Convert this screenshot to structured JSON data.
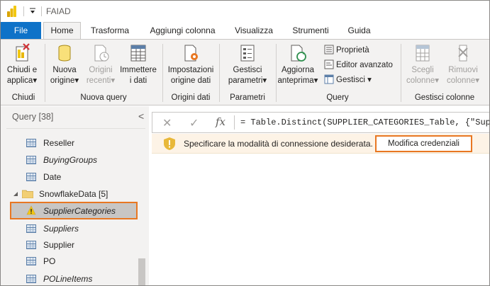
{
  "window": {
    "title": "FAIAD",
    "qat_symbol": "="
  },
  "tabs": [
    {
      "label": "File"
    },
    {
      "label": "Home"
    },
    {
      "label": "Trasforma"
    },
    {
      "label": "Aggiungi colonna"
    },
    {
      "label": "Visualizza"
    },
    {
      "label": "Strumenti"
    },
    {
      "label": "Guida"
    }
  ],
  "ribbon": {
    "close_apply": {
      "line1": "Chiudi e",
      "line2": "applica",
      "icon": "close-apply-icon"
    },
    "new_source": {
      "line1": "Nuova",
      "line2": "origine"
    },
    "recent_sources": {
      "line1": "Origini",
      "line2": "recenti"
    },
    "enter_data": {
      "line1": "Immettere",
      "line2": "i dati"
    },
    "source_settings": {
      "line1": "Impostazioni",
      "line2": "origine dati"
    },
    "manage_params": {
      "line1": "Gestisci",
      "line2": "parametri"
    },
    "refresh_preview": {
      "line1": "Aggiorna",
      "line2": "anteprima"
    },
    "properties": "Proprietà",
    "advanced_editor": "Editor avanzato",
    "manage": "Gestisci",
    "choose_columns": {
      "line1": "Scegli",
      "line2": "colonne"
    },
    "remove_columns": {
      "line1": "Rimuovi",
      "line2": "colonne"
    },
    "groups": {
      "close": "Chiudi",
      "new_query": "Nuova query",
      "data_sources": "Origini dati",
      "parameters": "Parametri",
      "query": "Query",
      "manage_columns": "Gestisci colonne"
    },
    "dropdown_caret": "▾"
  },
  "query_pane": {
    "header": "Query [38]",
    "collapse_symbol": "<",
    "items": [
      {
        "label": "Reseller"
      },
      {
        "label": "BuyingGroups"
      },
      {
        "label": "Date"
      },
      {
        "label": "SnowflakeData [5]"
      },
      {
        "label": "SupplierCategories"
      },
      {
        "label": "Suppliers"
      },
      {
        "label": "Supplier"
      },
      {
        "label": "PO"
      },
      {
        "label": "POLineItems"
      }
    ]
  },
  "formula_bar": {
    "cancel_symbol": "✕",
    "ok_symbol": "✓",
    "fx_label": "fx",
    "formula": "= Table.Distinct(SUPPLIER_CATEGORIES_Table, {\"Supplie"
  },
  "warning": {
    "message": "Specificare la modalità di connessione desiderata.",
    "button_label": "Modifica credenziali"
  },
  "colors": {
    "file_tab": "#0e72c8",
    "highlight": "#e87722",
    "warning_bg": "#fdf3e6",
    "warning_icon": "#e8b83a"
  }
}
